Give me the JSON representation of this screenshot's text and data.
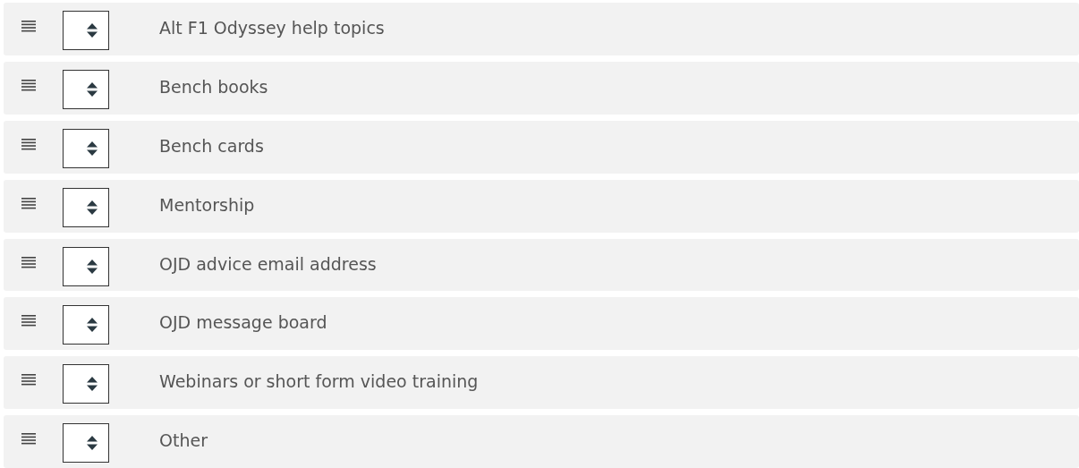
{
  "items": [
    {
      "label": "Alt F1 Odyssey help topics"
    },
    {
      "label": "Bench books"
    },
    {
      "label": "Bench cards"
    },
    {
      "label": "Mentorship"
    },
    {
      "label": "OJD advice email address"
    },
    {
      "label": "OJD message board"
    },
    {
      "label": "Webinars or short form video training"
    },
    {
      "label": "Other"
    }
  ]
}
